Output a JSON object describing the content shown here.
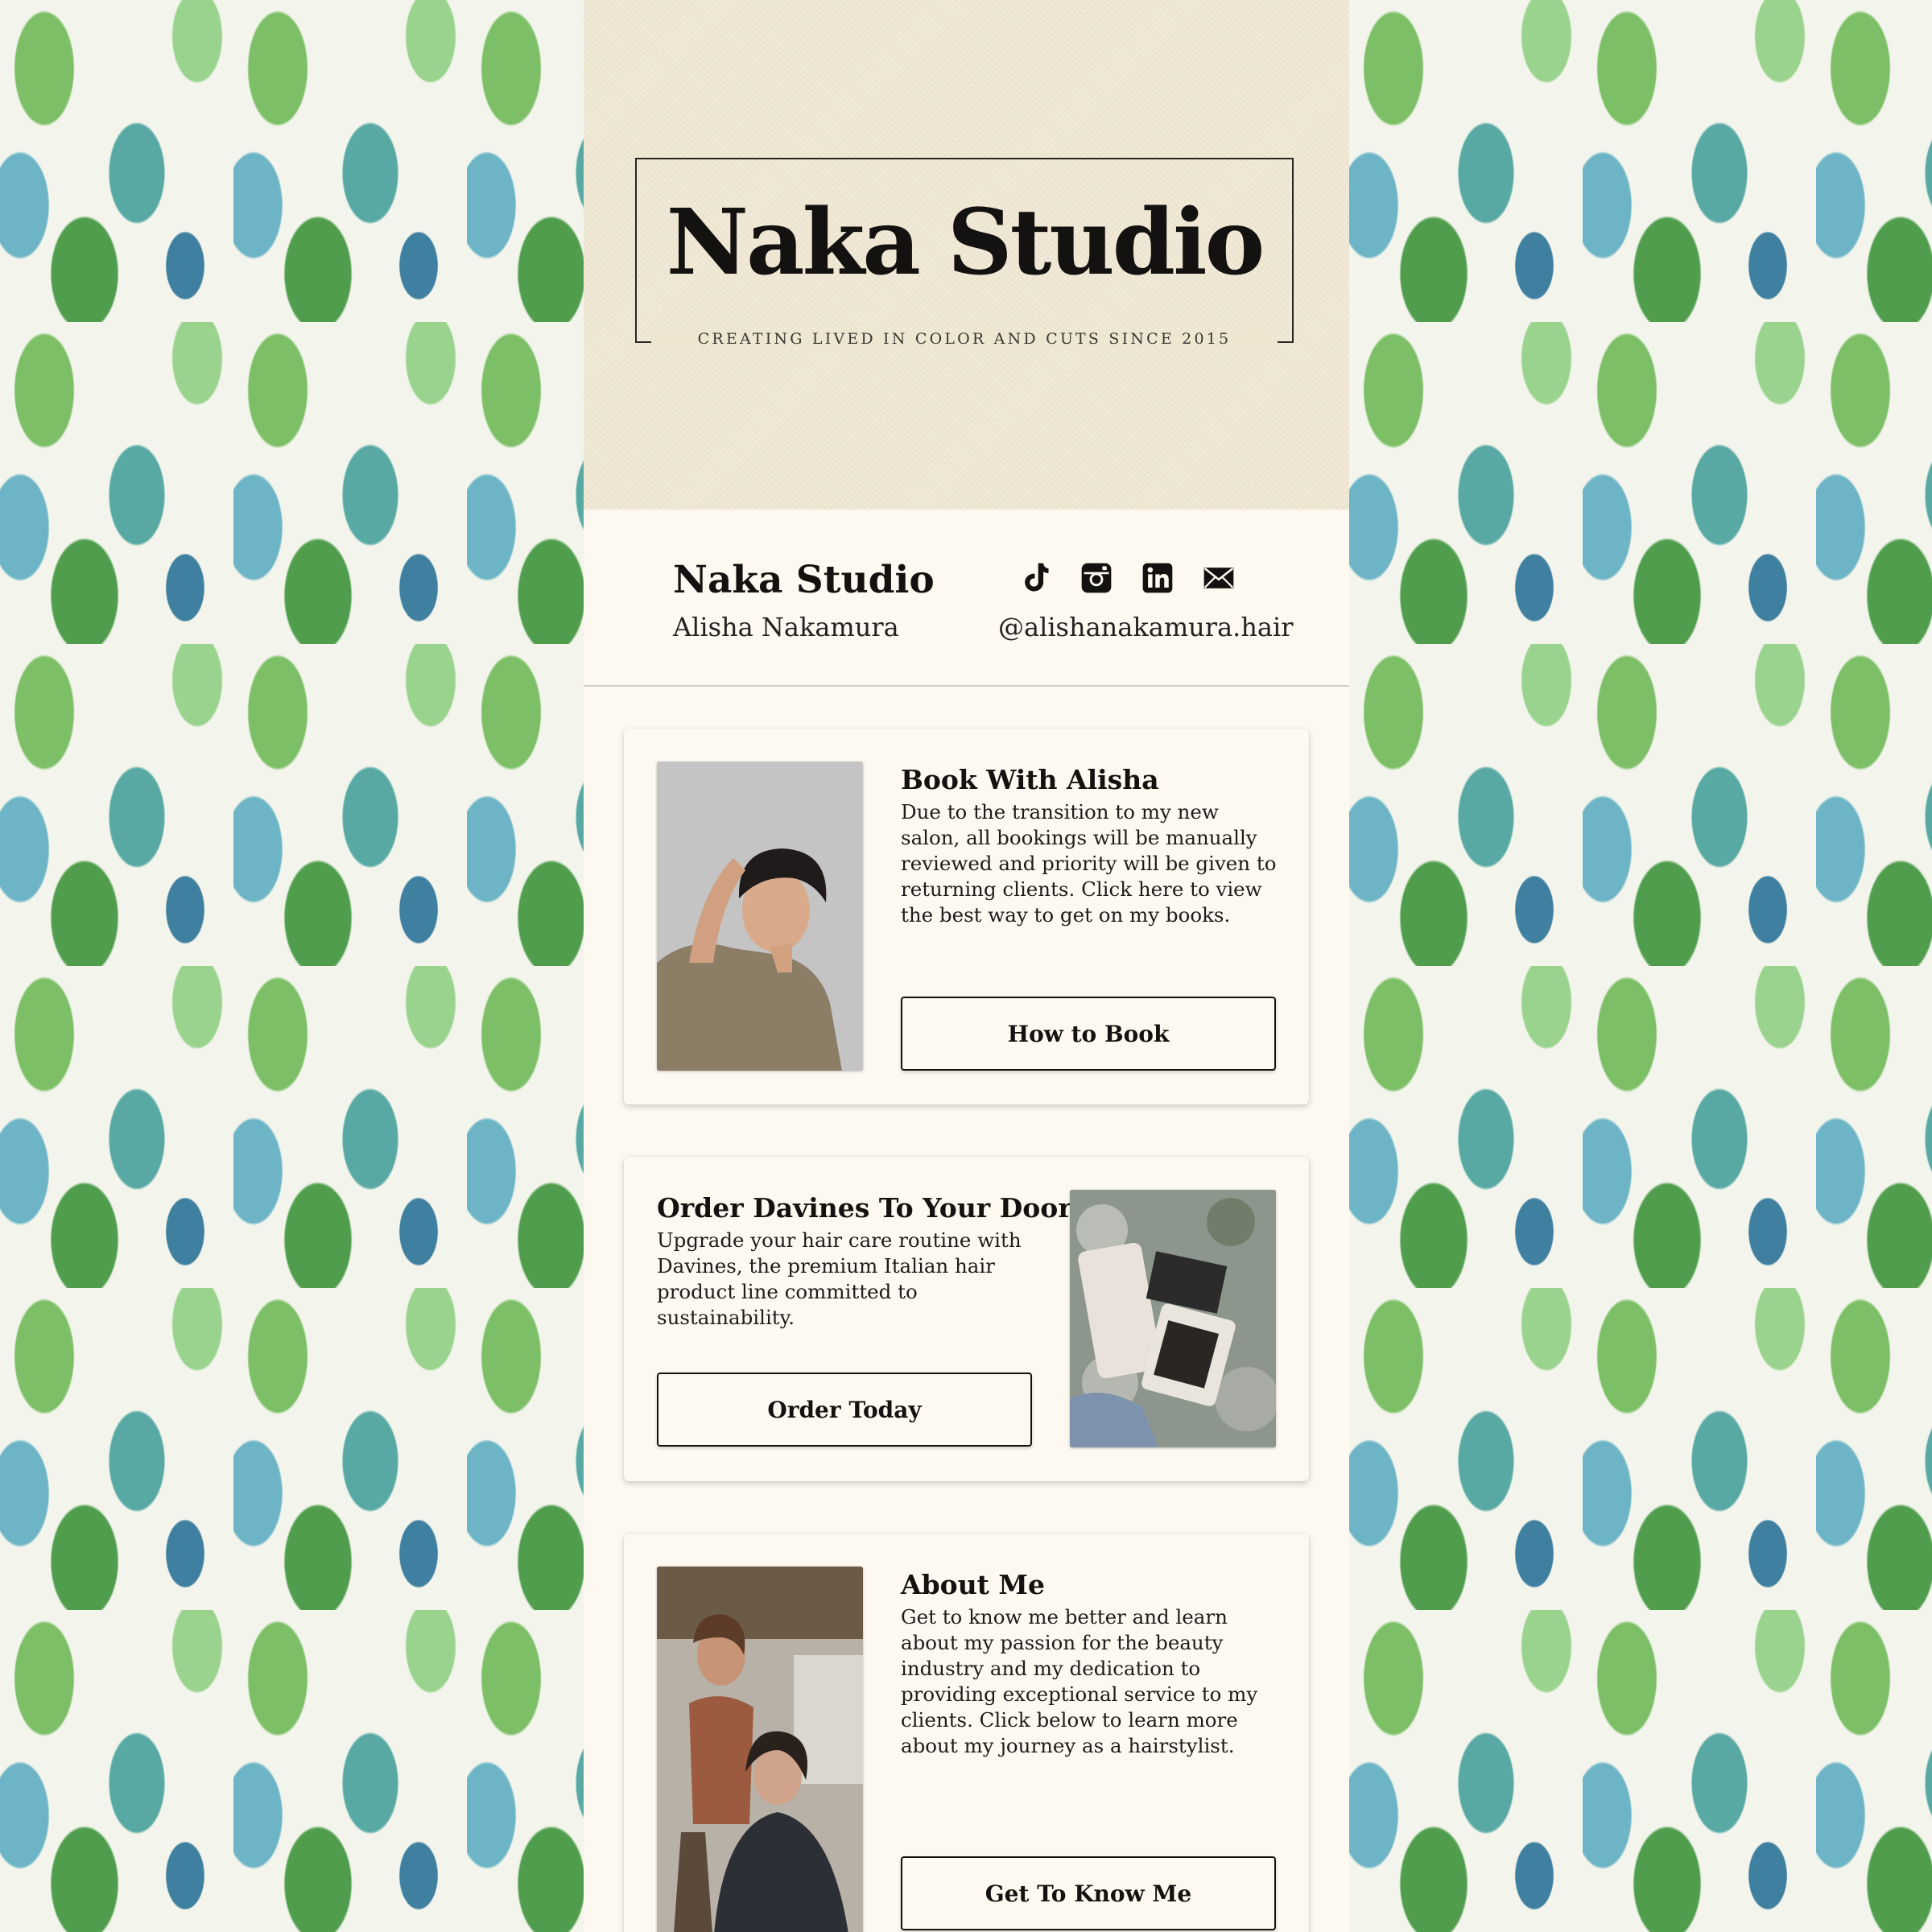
{
  "banner": {
    "logo_title": "Naka Studio",
    "logo_tagline": "CREATING LIVED IN COLOR AND CUTS SINCE 2015"
  },
  "profile": {
    "name": "Naka Studio",
    "person": "Alisha Nakamura",
    "handle": "@alishanakamura.hair",
    "social_icons": [
      "tiktok-icon",
      "instagram-icon",
      "linkedin-icon",
      "email-icon"
    ]
  },
  "cards": [
    {
      "title": "Book With Alisha",
      "body": "Due to the transition to my new salon, all bookings will be manually reviewed and priority will be given to returning clients. Click here to view the best way to get on my books.",
      "button": "How to Book"
    },
    {
      "title": "Order Davines To Your Door",
      "body": "Upgrade your hair care routine with Davines, the premium Italian hair product line committed to sustainability.",
      "button": "Order Today"
    },
    {
      "title": "About Me",
      "body": "Get to know me better and learn about my passion for the beauty industry and my dedication to providing exceptional service to my clients. Click below to learn more about my journey as a hairstylist.",
      "button": "Get To Know Me"
    }
  ],
  "colors": {
    "page_background": "#fdf9f0",
    "banner_background": "#efe6d2",
    "text": "#141210",
    "cactus_green": "#5aa75a",
    "cactus_teal": "#5aa7a0"
  }
}
